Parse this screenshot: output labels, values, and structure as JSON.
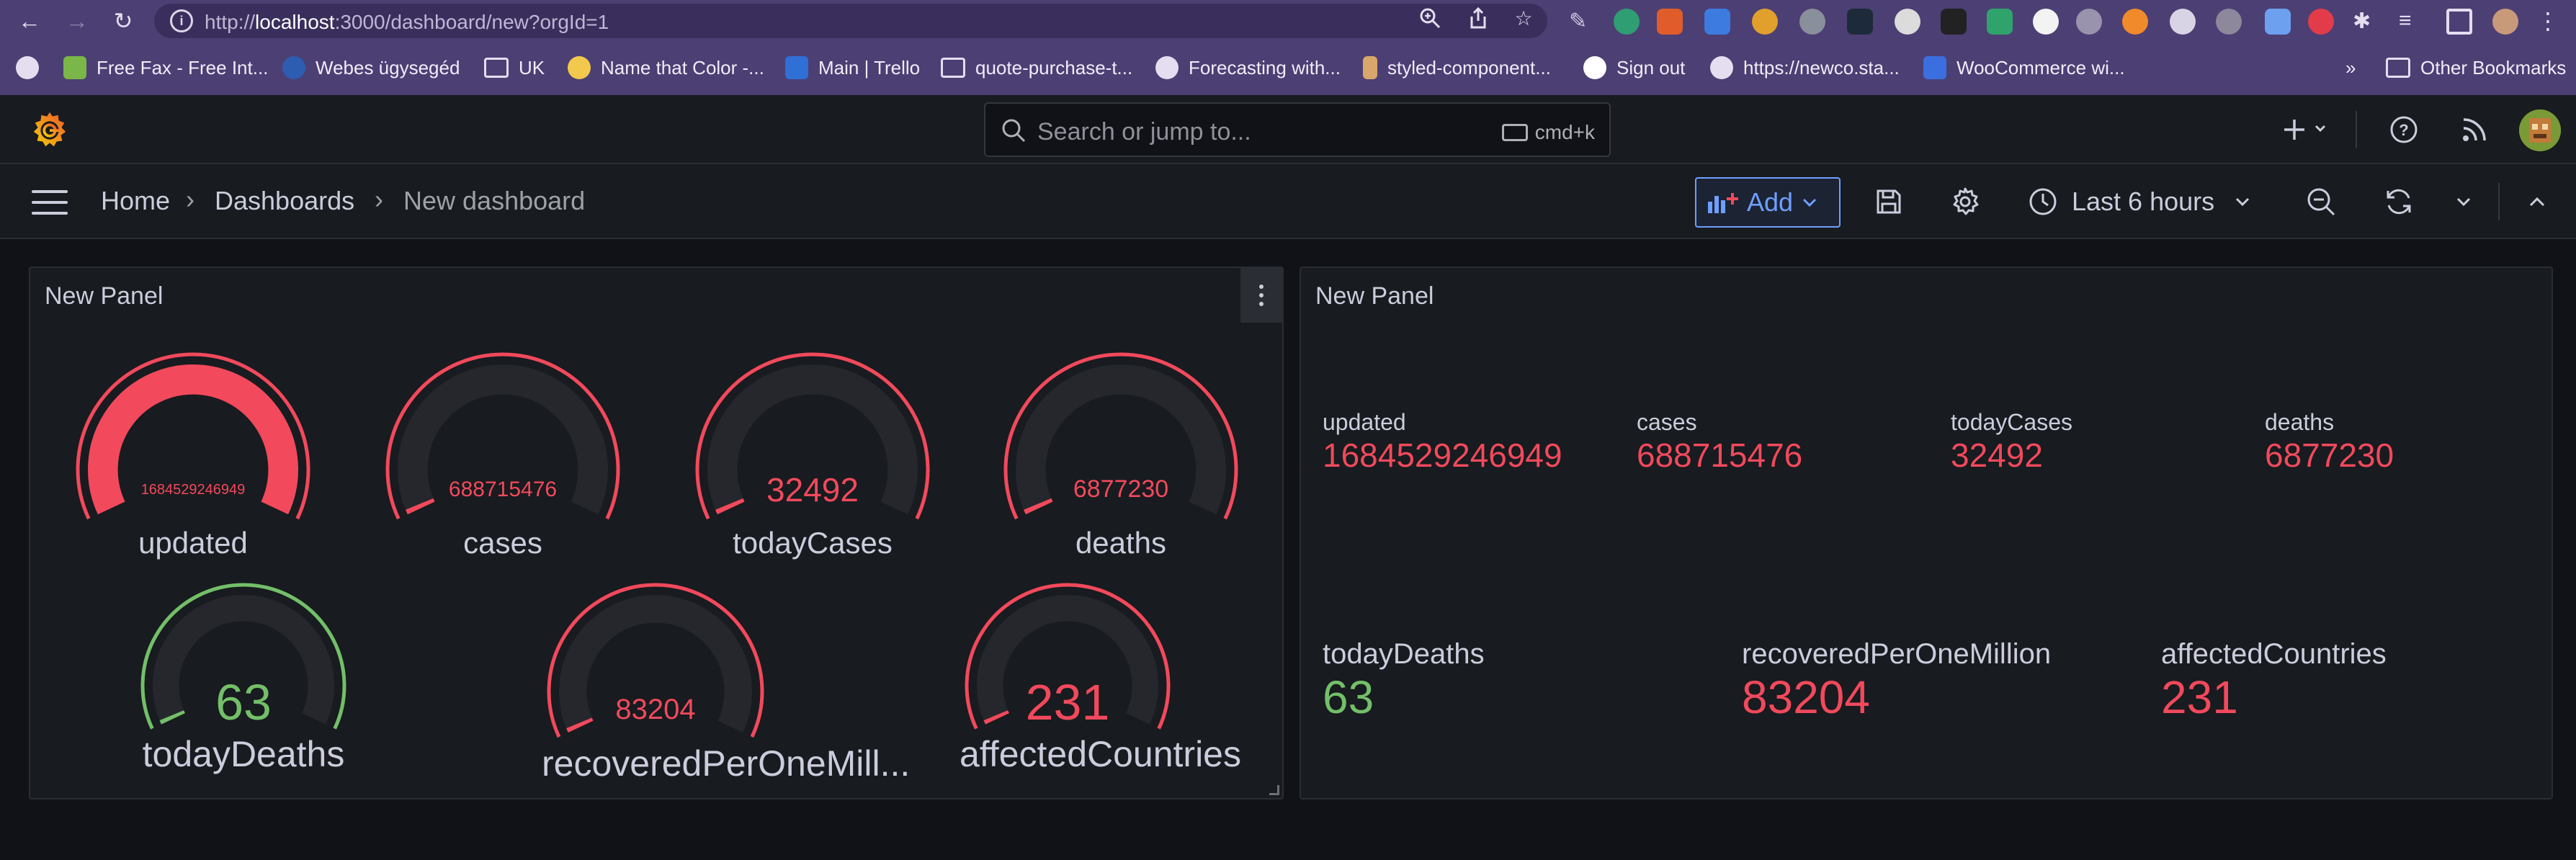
{
  "browser": {
    "url_prefix": "http://",
    "url_host": "localhost",
    "url_rest": ":3000/dashboard/new?orgId=1",
    "bookmarks": [
      "Free Fax - Free Int...",
      "Webes ügysegéd",
      "UK",
      "Name that Color -...",
      "Main | Trello",
      "quote-purchase-t...",
      "Forecasting with...",
      "styled-component...",
      "Sign out",
      "https://newco.sta...",
      "WooCommerce wi..."
    ],
    "more": "»",
    "other_bookmarks": "Other Bookmarks"
  },
  "topbar": {
    "search_placeholder": "Search or jump to...",
    "shortcut": "cmd+k"
  },
  "breadcrumb": {
    "home": "Home",
    "dashboards": "Dashboards",
    "current": "New dashboard"
  },
  "toolbar": {
    "add_label": "Add",
    "time_range": "Last 6 hours"
  },
  "colors": {
    "red": "#f2495c",
    "green": "#73bf69"
  },
  "gauge_panel": {
    "title": "New Panel",
    "gauges": [
      {
        "label": "updated",
        "value": "1684529246949",
        "color": "red",
        "fill": 1.0
      },
      {
        "label": "cases",
        "value": "688715476",
        "color": "red",
        "fill": 0.0
      },
      {
        "label": "todayCases",
        "value": "32492",
        "color": "red",
        "fill": 0.0
      },
      {
        "label": "deaths",
        "value": "6877230",
        "color": "red",
        "fill": 0.0
      },
      {
        "label": "todayDeaths",
        "value": "63",
        "color": "green",
        "fill": 0.0
      },
      {
        "label": "recoveredPerOneMill...",
        "value": "83204",
        "color": "red",
        "fill": 0.0
      },
      {
        "label": "affectedCountries",
        "value": "231",
        "color": "red",
        "fill": 0.0
      }
    ]
  },
  "stat_panel": {
    "title": "New Panel",
    "stats": [
      {
        "label": "updated",
        "value": "1684529246949",
        "color": "red"
      },
      {
        "label": "cases",
        "value": "688715476",
        "color": "red"
      },
      {
        "label": "todayCases",
        "value": "32492",
        "color": "red"
      },
      {
        "label": "deaths",
        "value": "6877230",
        "color": "red"
      },
      {
        "label": "todayDeaths",
        "value": "63",
        "color": "green"
      },
      {
        "label": "recoveredPerOneMillion",
        "value": "83204",
        "color": "red"
      },
      {
        "label": "affectedCountries",
        "value": "231",
        "color": "red"
      }
    ]
  }
}
